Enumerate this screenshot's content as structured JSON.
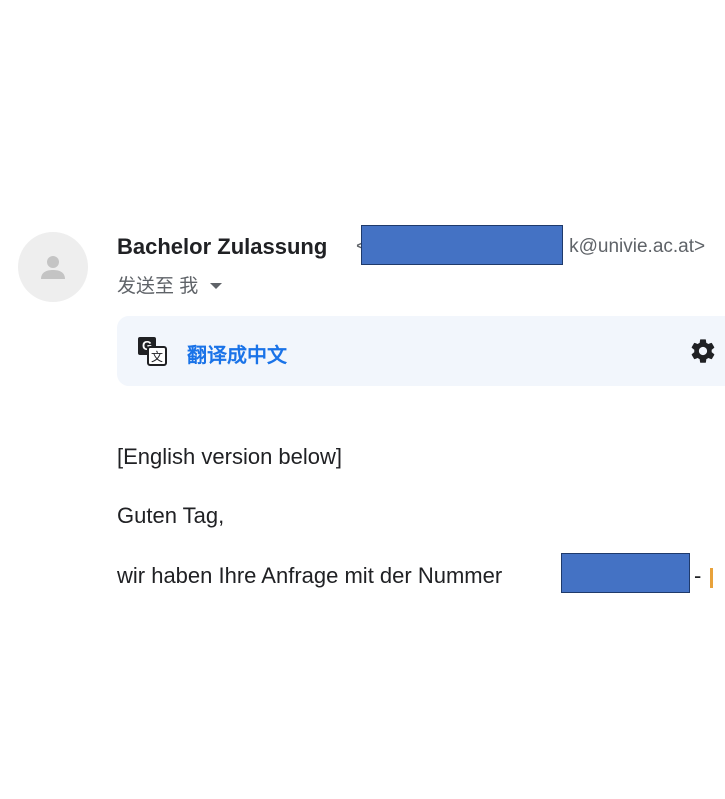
{
  "email": {
    "sender_name": "Bachelor Zulassung",
    "sender_email_suffix": "<...k@univie.ac.at>",
    "sender_email_visible": "k@univie.ac.at>",
    "recipient_label": "发送至 我",
    "translate_label": "翻译成中文",
    "body": {
      "line1": "[English version below]",
      "line2": "Guten Tag,",
      "line3": "wir haben Ihre Anfrage mit der Nummer",
      "line3_trailing": "-"
    }
  },
  "colors": {
    "redaction": "#4472c4",
    "link": "#1a73e8",
    "translate_bg": "#f2f6fc"
  },
  "icons": [
    "avatar-person-icon",
    "translate-icon",
    "gear-icon",
    "chevron-down-icon"
  ]
}
